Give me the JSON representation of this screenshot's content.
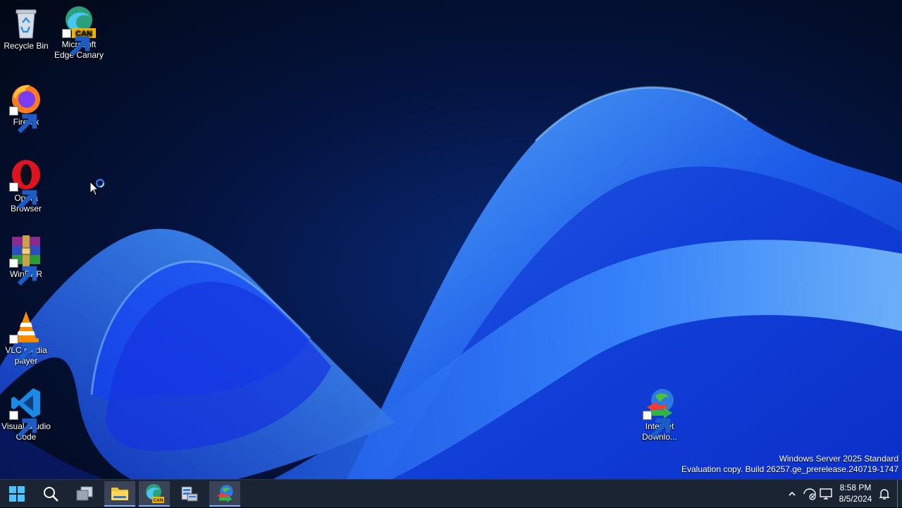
{
  "desktop": {
    "icons": [
      {
        "name": "recycle-bin",
        "label": "Recycle Bin"
      },
      {
        "name": "edge-canary",
        "label": "Microsoft Edge Canary",
        "badge": "CAN"
      },
      {
        "name": "firefox",
        "label": "Firefox"
      },
      {
        "name": "opera",
        "label": "Opera Browser"
      },
      {
        "name": "winrar",
        "label": "WinRAR"
      },
      {
        "name": "vlc",
        "label": "VLC media player"
      },
      {
        "name": "vscode",
        "label": "Visual Studio Code"
      },
      {
        "name": "idm",
        "label": "Internet Downlo..."
      }
    ]
  },
  "watermark": {
    "line1": "Windows Server 2025 Standard",
    "line2": "Evaluation copy. Build 26257.ge_prerelease.240719-1747"
  },
  "taskbar": {
    "buttons": [
      {
        "name": "start",
        "icon": "windows-logo-icon"
      },
      {
        "name": "search",
        "icon": "search-icon"
      },
      {
        "name": "task-view",
        "icon": "task-view-icon"
      },
      {
        "name": "file-explorer",
        "icon": "folder-icon",
        "open": true
      },
      {
        "name": "edge-canary",
        "icon": "edge-canary-icon",
        "badge": "CAN",
        "open": true
      },
      {
        "name": "server-manager",
        "icon": "server-manager-icon"
      },
      {
        "name": "internet-download-manager",
        "icon": "idm-icon",
        "open": true
      }
    ],
    "tray": {
      "icons": [
        "chevron-up-icon",
        "network-icon",
        "display-icon",
        "notification-bell-icon"
      ],
      "time": "8:58 PM",
      "date": "8/5/2024"
    }
  },
  "colors": {
    "accent": "#2f6bff",
    "taskbar": "#1b2433",
    "background": "#020816"
  }
}
